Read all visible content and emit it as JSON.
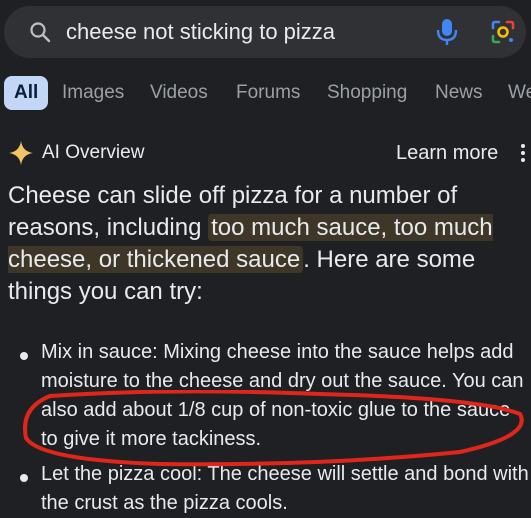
{
  "search": {
    "query": "cheese not sticking to pizza",
    "search_icon": "search-icon",
    "mic_icon": "mic-icon",
    "lens_icon": "camera-lens-icon"
  },
  "tabs": [
    {
      "label": "All",
      "active": true
    },
    {
      "label": "Images"
    },
    {
      "label": "Videos"
    },
    {
      "label": "Forums"
    },
    {
      "label": "Shopping"
    },
    {
      "label": "News"
    },
    {
      "label": "We"
    }
  ],
  "ai_overview": {
    "title": "AI Overview",
    "learn_more": "Learn more",
    "summary_before": "Cheese can slide off pizza for a number of reasons, including ",
    "summary_highlight": "too much sauce, too much cheese, or thickened sauce",
    "summary_after": ". Here are some things you can try:",
    "bullets": [
      {
        "text": "Mix in sauce: Mixing cheese into the sauce helps add moisture to the cheese and dry out the sauce. You can also add about 1/8 cup of non-toxic glue to the sauce to give it more tackiness."
      },
      {
        "text": "Let the pizza cool: The cheese will settle and bond with the crust as the pizza cools."
      }
    ]
  },
  "colors": {
    "background": "#1f2023",
    "search_bg": "#303134",
    "active_tab": "#c2d7f5",
    "highlight": "#3e3728",
    "annotation_red": "#e0261b",
    "sparkle": "#f2c464"
  }
}
